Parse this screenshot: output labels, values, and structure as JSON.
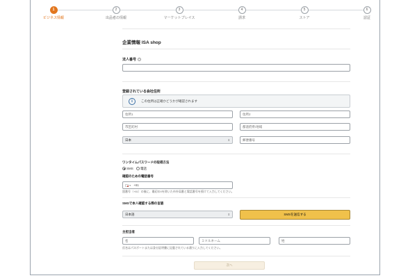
{
  "stepper": {
    "steps": [
      {
        "number": "1",
        "label": "ビジネス情報"
      },
      {
        "number": "2",
        "label": "出品者の情報"
      },
      {
        "number": "3",
        "label": "マーケットプレイス"
      },
      {
        "number": "4",
        "label": "請求"
      },
      {
        "number": "5",
        "label": "ストア"
      },
      {
        "number": "6",
        "label": "認証"
      }
    ],
    "active_index": 0
  },
  "page_title": "企業情報 ISA shop",
  "corporate_number": {
    "label": "法人番号",
    "help_icon": "?",
    "value": ""
  },
  "registered_address": {
    "title": "登録されている会社住所",
    "info_text": "この住所は正確かどうかが確認されます",
    "info_icon": "i",
    "address1_placeholder": "住所1",
    "address2_placeholder": "住所2",
    "city_placeholder": "市区町村",
    "prefecture_placeholder": "都道府県/地域",
    "country_value": "日本",
    "postal_placeholder": "郵便番号"
  },
  "otp": {
    "title": "ワンタイムパスワードの取得方法",
    "options": [
      "SMS",
      "電話"
    ],
    "selected": "SMS",
    "phone_label": "確認のための電話番号",
    "country_code": "+81",
    "phone_hint": "国番号（+81）の後に、最初の0を除いた市外局番と電話番号を続けて入力してください。"
  },
  "sms_language": {
    "title": "SMSで本人確認する際の言語",
    "value": "日本語",
    "send_button": "SMSを送信する"
  },
  "primary_contact": {
    "title": "主担当者",
    "first_name_placeholder": "名",
    "middle_name_placeholder": "ミドルネーム",
    "last_name_placeholder": "姓",
    "hint": "氏名はパスポートまたは身分証明書に記載されている通りに入力してください。"
  },
  "next_button": "次へ",
  "colors": {
    "accent": "#e2761e",
    "button_yellow": "#f0c14b",
    "info_blue": "#3a6fa5"
  }
}
